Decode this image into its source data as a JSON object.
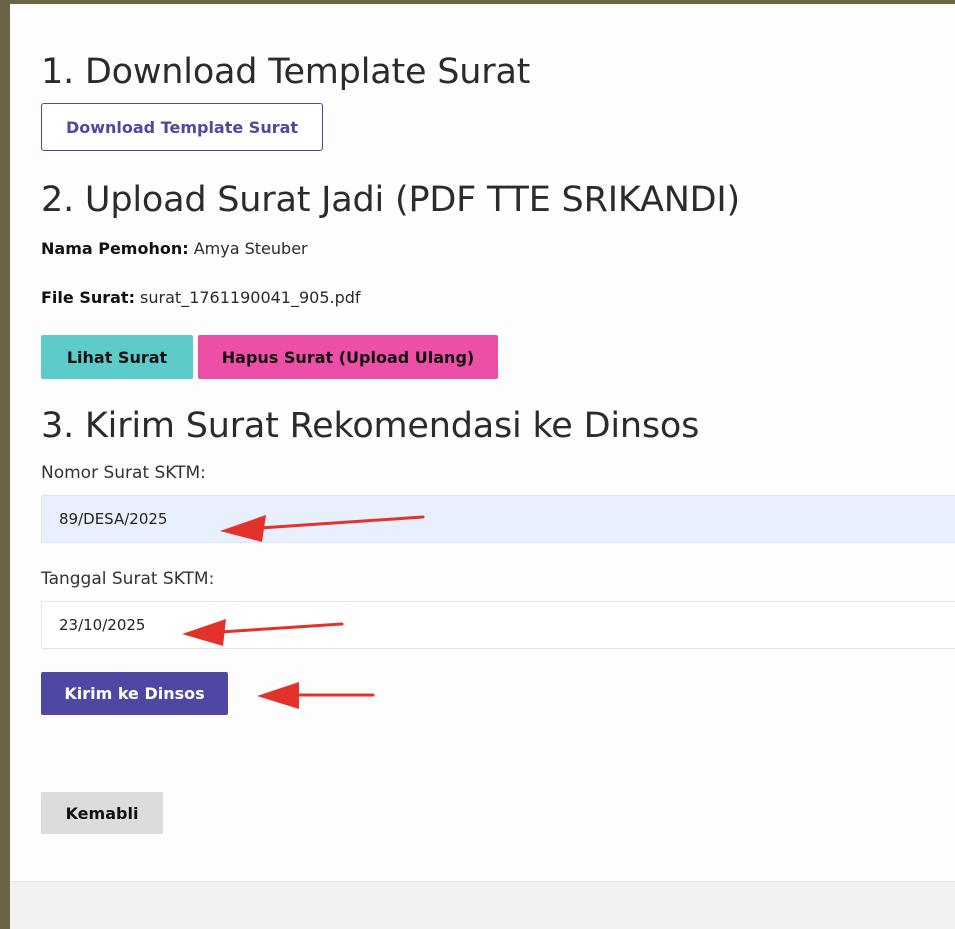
{
  "section1": {
    "heading": "1. Download Template Surat",
    "download_button": "Download Template Surat"
  },
  "section2": {
    "heading": "2. Upload Surat Jadi (PDF TTE SRIKANDI)",
    "applicant_label": "Nama Pemohon:",
    "applicant_value": " Amya Steuber",
    "file_label": "File Surat:",
    "file_value": " surat_1761190041_905.pdf",
    "view_button": "Lihat Surat",
    "delete_button": "Hapus Surat (Upload Ulang)"
  },
  "section3": {
    "heading": "3. Kirim Surat Rekomendasi ke Dinsos",
    "number_label": "Nomor Surat SKTM:",
    "number_value": "89/DESA/2025",
    "date_label": "Tanggal Surat SKTM:",
    "date_value": "23/10/2025",
    "send_button": "Kirim ke Dinsos"
  },
  "back_button": "Kemabli",
  "colors": {
    "primary": "#4e48a3",
    "teal": "#5ccbc9",
    "pink": "#ee4fa6",
    "annotation_arrow": "#e3322b"
  },
  "annotations": [
    "red-arrow-icon",
    "red-arrow-icon",
    "red-arrow-icon"
  ]
}
